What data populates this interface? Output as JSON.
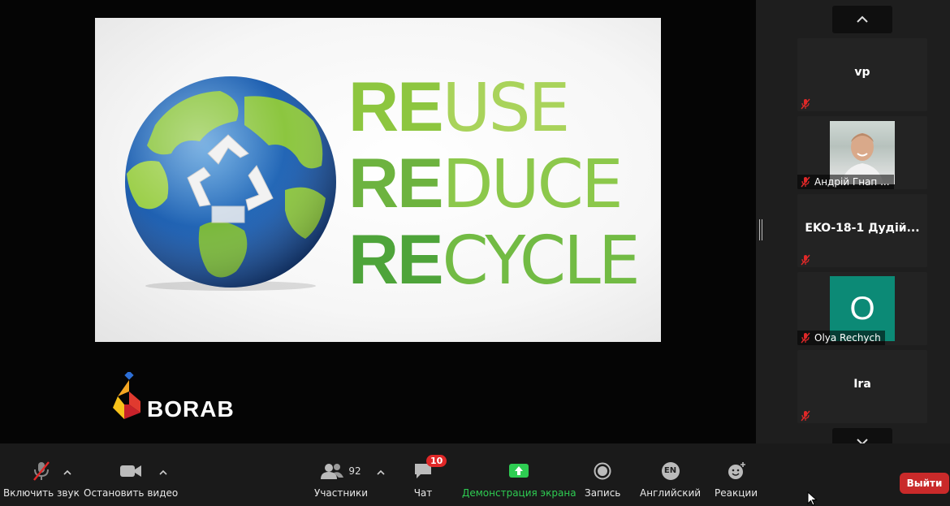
{
  "slide": {
    "words": [
      {
        "prefix": "RE",
        "rest": "USE"
      },
      {
        "prefix": "RE",
        "rest": "DUCE"
      },
      {
        "prefix": "RE",
        "rest": "CYCLE"
      }
    ],
    "logo_text": "BORAB"
  },
  "participants": [
    {
      "name": "vp",
      "type": "name-only"
    },
    {
      "name": "Андрій Гнап ...",
      "type": "photo"
    },
    {
      "name": "EKO-18-1 Дудій...",
      "type": "name-only"
    },
    {
      "name": "Olya Rechych",
      "type": "letter",
      "letter": "O",
      "color": "#0c8a76"
    },
    {
      "name": "Ira",
      "type": "name-only"
    }
  ],
  "toolbar": {
    "unmute_label": "Включить звук",
    "stop_video_label": "Остановить видео",
    "participants_label": "Участники",
    "participants_count": "92",
    "chat_label": "Чат",
    "chat_badge": "10",
    "share_label": "Демонстрация экрана",
    "record_label": "Запись",
    "language_label": "Английский",
    "language_code": "EN",
    "reactions_label": "Реакции",
    "leave_label": "Выйти"
  },
  "colors": {
    "share_green": "#2ecc52",
    "leave_red": "#c92a2a",
    "mic_off_red": "#e02828"
  }
}
